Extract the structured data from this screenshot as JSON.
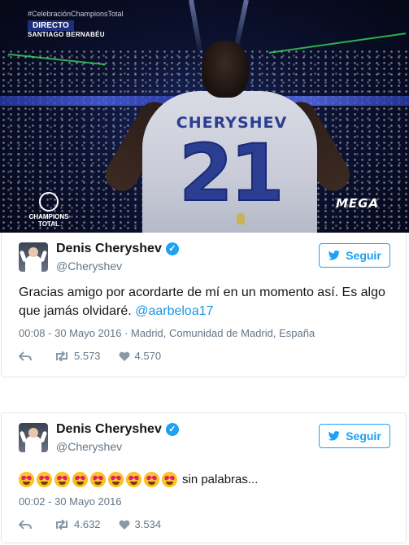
{
  "broadcast": {
    "hashtag": "#CelebraciónChampionsTotal",
    "live_label": "DIRECTO",
    "location_label": "SANTIAGO BERNABÉU",
    "shirt_name": "CHERYSHEV",
    "shirt_number": "21",
    "program_logo": "CHAMPIONS TOTAL",
    "channel_logo": "MEGA"
  },
  "tweets": [
    {
      "display_name": "Denis Cheryshev",
      "handle": "@Cheryshev",
      "follow_label": "Seguir",
      "text": "Gracias amigo por acordarte de mí en un momento así. Es algo que jamás olvidaré.",
      "mention": "@aarbeloa17",
      "timestamp": "00:08 - 30 Mayo 2016 · Madrid, Comunidad de Madrid, España",
      "retweets": "5.573",
      "likes": "4.570"
    },
    {
      "display_name": "Denis Cheryshev",
      "handle": "@Cheryshev",
      "follow_label": "Seguir",
      "emoji_count": 9,
      "text": "sin palabras...",
      "timestamp": "00:02 - 30 Mayo 2016",
      "retweets": "4.632",
      "likes": "3.534"
    }
  ],
  "icons": {
    "verified": "verified-badge-icon",
    "bird": "twitter-bird-icon",
    "reply": "reply-icon",
    "retweet": "retweet-icon",
    "like": "heart-icon",
    "emoji": "heart-eyes-emoji-icon"
  },
  "colors": {
    "accent": "#1da1f2",
    "mention": "#1b95e0",
    "muted": "#657786",
    "text": "#14171a"
  }
}
